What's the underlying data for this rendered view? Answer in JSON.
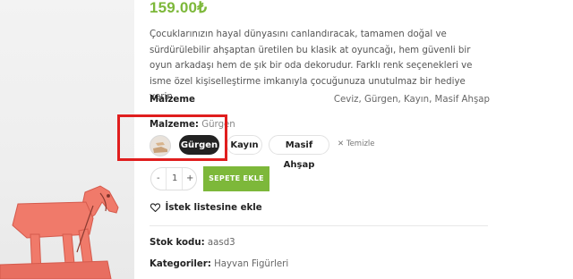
{
  "product": {
    "price": "159.00₺",
    "description": "Çocuklarınızın hayal dünyasını canlandıracak, tamamen doğal ve sürdürülebilir ahşaptan üretilen bu klasik at oyuncağı, hem güvenli bir oyun arkadaşı hem de şık bir oda dekorudur. Farklı renk seçenekleri ve isme özel kişiselleştirme imkanıyla çocuğunuza unutulmaz bir hediye verin.",
    "attribute_label": "Malzeme",
    "attribute_value": "Ceviz, Gürgen, Kayın, Masif Ahşap"
  },
  "variation": {
    "label": "Malzeme:",
    "selected_value": "Gürgen",
    "options": [
      "Gürgen",
      "Kayın",
      "Masif Ahşap"
    ],
    "clear_label": "Temizle"
  },
  "cart": {
    "quantity": "1",
    "minus": "-",
    "plus": "+",
    "add_to_cart_label": "SEPETE EKLE"
  },
  "wishlist_label": "İstek listesine ekle",
  "meta": {
    "sku_label": "Stok kodu:",
    "sku_value": "aasd3",
    "categories_label": "Kategoriler:",
    "categories_value": "Hayvan Figürleri"
  },
  "colors": {
    "price": "#7db83a",
    "add_to_cart": "#7db83a",
    "selected_pill": "#222222",
    "highlight": "#e01e1e",
    "toy": "#f07a6a"
  },
  "icons": {
    "heart": "heart-icon",
    "clear": "close-icon"
  }
}
